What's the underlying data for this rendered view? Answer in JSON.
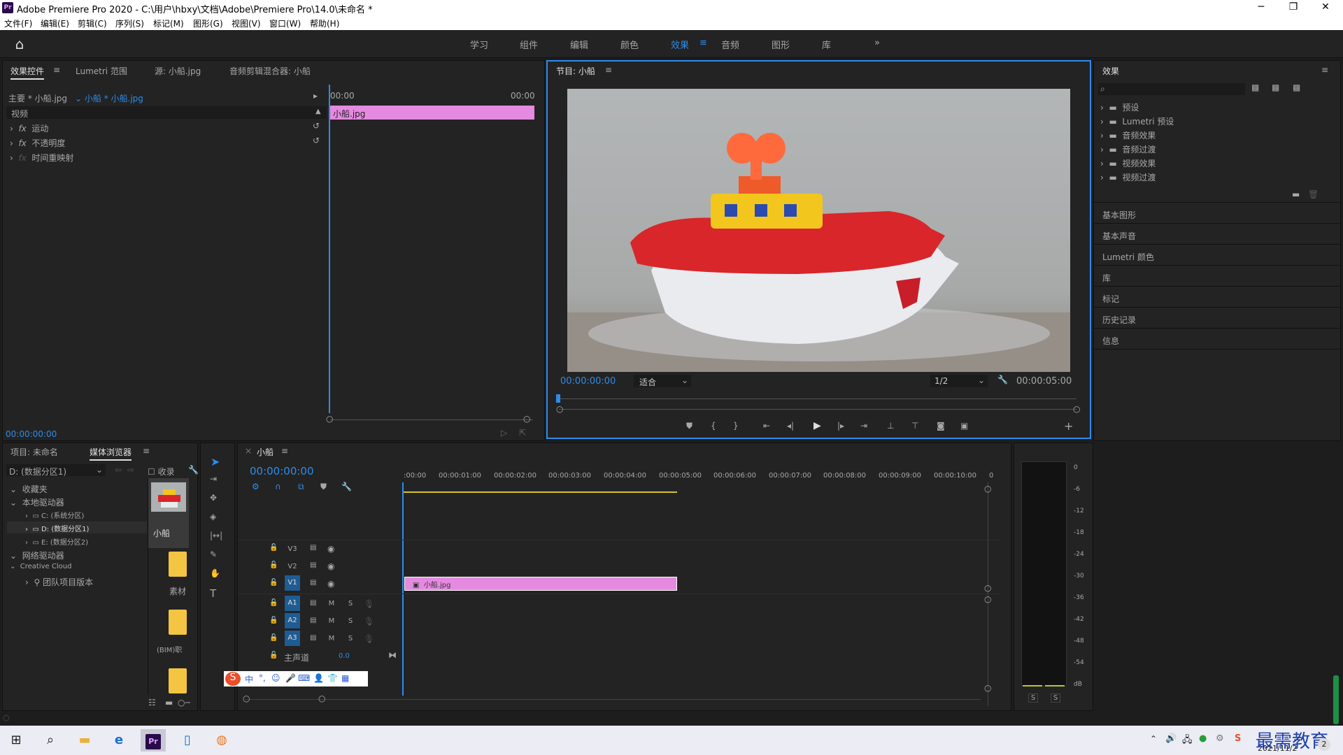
{
  "window": {
    "title": "Adobe Premiere Pro 2020 - C:\\用户\\hbxy\\文档\\Adobe\\Premiere Pro\\14.0\\未命名 *",
    "app_icon": "Pr"
  },
  "menu": [
    "文件(F)",
    "编辑(E)",
    "剪辑(C)",
    "序列(S)",
    "标记(M)",
    "图形(G)",
    "视图(V)",
    "窗口(W)",
    "帮助(H)"
  ],
  "workspaces": [
    "学习",
    "组件",
    "编辑",
    "颜色",
    "效果",
    "音频",
    "图形",
    "库"
  ],
  "workspace_active": "效果",
  "effect_controls": {
    "tabs": [
      "效果控件",
      "Lumetri 范围",
      "源: 小船.jpg",
      "音频剪辑混合器: 小船"
    ],
    "master": "主要 * 小船.jpg",
    "clip": "小船 * 小船.jpg",
    "time_start": "00:00",
    "time_end": "00:00",
    "section": "视频",
    "clip_name": "小船.jpg",
    "effects": [
      "运动",
      "不透明度",
      "时间重映射"
    ],
    "timecode": "00:00:00:00"
  },
  "program": {
    "title": "节目: 小船",
    "timecode": "00:00:00:00",
    "fit": "适合",
    "resolution": "1/2",
    "duration": "00:00:05:00"
  },
  "effects_panel": {
    "title": "效果",
    "folders": [
      "预设",
      "Lumetri 预设",
      "音频效果",
      "音频过渡",
      "视频效果",
      "视频过渡"
    ],
    "sections": [
      "基本图形",
      "基本声音",
      "Lumetri 颜色",
      "库",
      "标记",
      "历史记录",
      "信息"
    ]
  },
  "project": {
    "tabs": [
      "项目: 未命名",
      "媒体浏览器"
    ],
    "drive": "D: (数据分区1)",
    "ingest": "收录",
    "tree": [
      "收藏夹",
      "本地驱动器",
      "C: (系统分区)",
      "D: (数据分区1)",
      "E: (数据分区2)",
      "网络驱动器",
      "Creative Cloud",
      "团队项目版本"
    ],
    "thumbs": [
      "小船",
      "素材",
      "(BIM)职",
      ""
    ]
  },
  "timeline": {
    "title": "小船",
    "timecode": "00:00:00:00",
    "ruler": [
      ":00:00",
      "00:00:01:00",
      "00:00:02:00",
      "00:00:03:00",
      "00:00:04:00",
      "00:00:05:00",
      "00:00:06:00",
      "00:00:07:00",
      "00:00:08:00",
      "00:00:09:00",
      "00:00:10:00",
      "0"
    ],
    "video_tracks": [
      "V3",
      "V2",
      "V1"
    ],
    "audio_tracks": [
      "A1",
      "A2",
      "A3"
    ],
    "master_label": "主声道",
    "master_value": "0.0",
    "clip": "小船.jpg",
    "m": "M",
    "s": "S"
  },
  "meter": {
    "scale": [
      "0",
      "-6",
      "-12",
      "-18",
      "-24",
      "-30",
      "-36",
      "-42",
      "-48",
      "-54",
      "dB"
    ],
    "solo": [
      "S",
      "S"
    ]
  },
  "taskbar": {
    "date": "2021/11/2",
    "watermark": "最需教育",
    "badge": "2"
  }
}
